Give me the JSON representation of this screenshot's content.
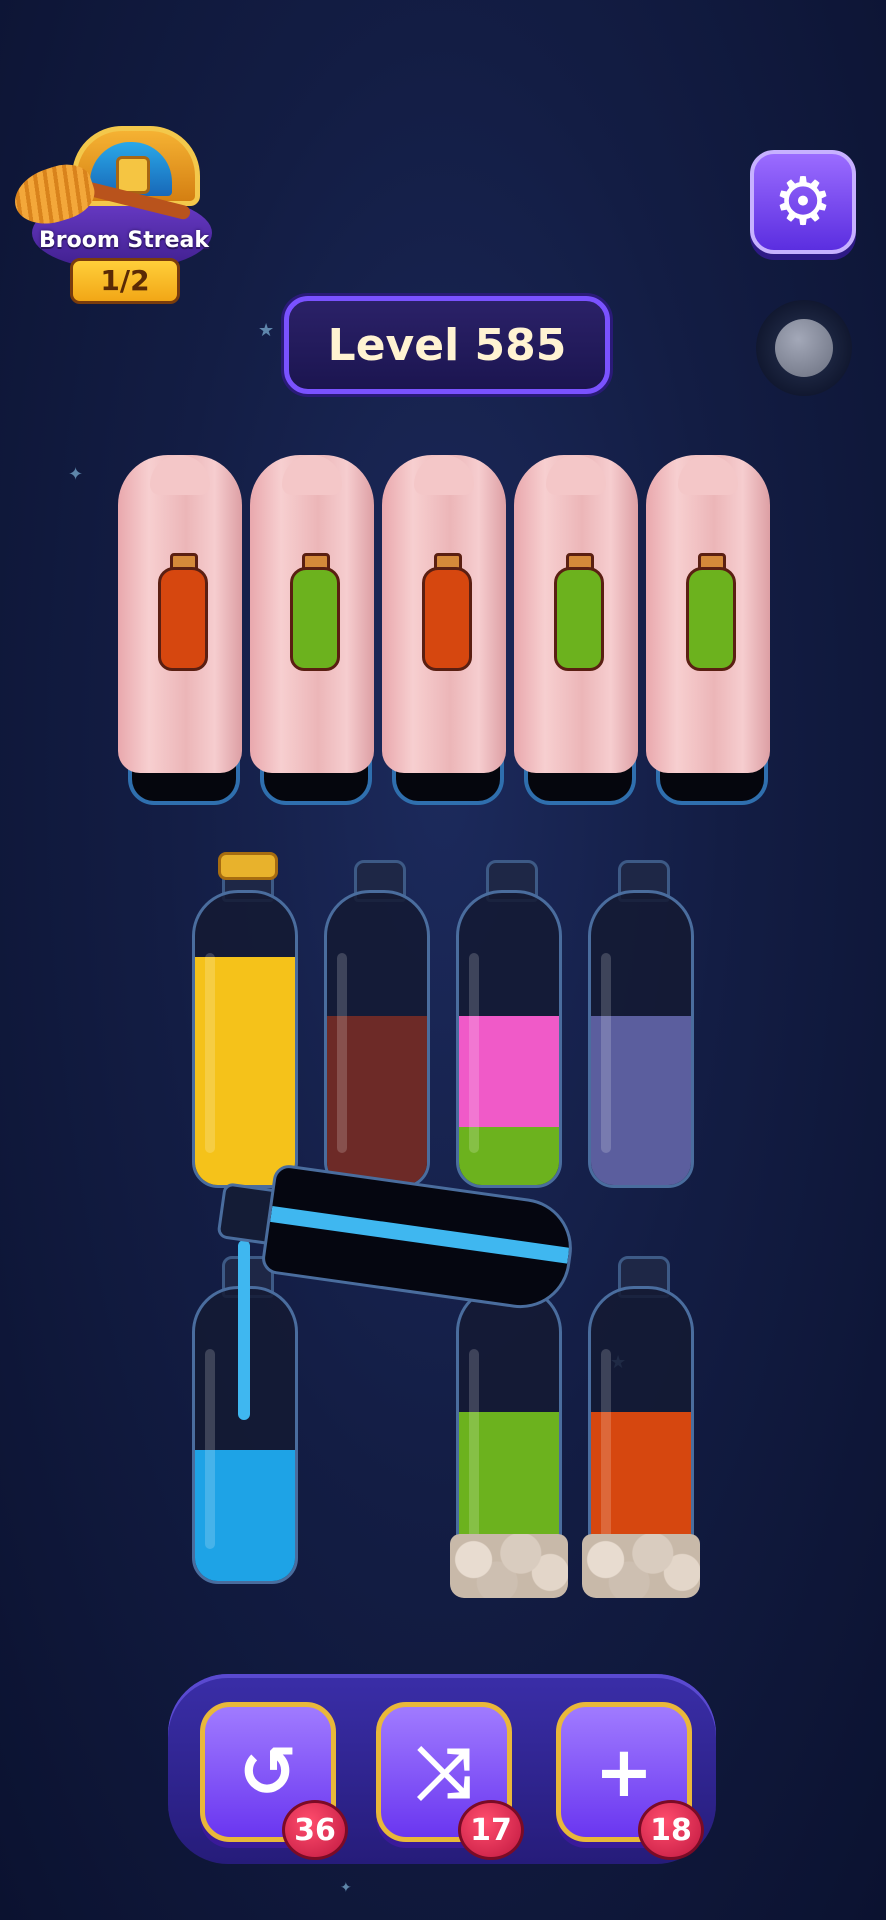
{
  "streak": {
    "title": "Broom Streak",
    "progress": "1/2"
  },
  "level": {
    "label": "Level 585"
  },
  "settings": {
    "icon": "gear-icon"
  },
  "covered_bottles": [
    {
      "hint_color": "#d6470f"
    },
    {
      "hint_color": "#6cb21e"
    },
    {
      "hint_color": "#d6470f"
    },
    {
      "hint_color": "#6cb21e"
    },
    {
      "hint_color": "#6cb21e"
    }
  ],
  "bottles": [
    {
      "layers": [
        {
          "color": "#f5c21a",
          "fraction": 0.78
        }
      ],
      "corked": true,
      "rocks": false
    },
    {
      "layers": [
        {
          "color": "#6d2a27",
          "fraction": 0.58
        }
      ],
      "corked": false,
      "rocks": false
    },
    {
      "layers": [
        {
          "color": "#6cb21e",
          "fraction": 0.2
        },
        {
          "color": "#f05ac8",
          "fraction": 0.38
        }
      ],
      "corked": false,
      "rocks": false
    },
    {
      "layers": [
        {
          "color": "#5b5e9e",
          "fraction": 0.58
        }
      ],
      "corked": false,
      "rocks": false
    },
    {
      "layers": [
        {
          "color": "#1ea3e6",
          "fraction": 0.45
        }
      ],
      "corked": false,
      "rocks": false
    },
    {
      "layers": [
        {
          "color": "#6cb21e",
          "fraction": 0.58
        }
      ],
      "corked": false,
      "rocks": true
    },
    {
      "layers": [
        {
          "color": "#d6470f",
          "fraction": 0.58
        }
      ],
      "corked": false,
      "rocks": true
    }
  ],
  "pouring": {
    "color": "#3fb7f0"
  },
  "powerups": [
    {
      "name": "undo",
      "icon": "undo-icon",
      "glyph": "↺",
      "count": "36"
    },
    {
      "name": "shuffle",
      "icon": "shuffle-icon",
      "glyph": "⤨",
      "count": "17"
    },
    {
      "name": "add-bottle",
      "icon": "add-bottle-icon",
      "glyph": "+",
      "count": "18"
    }
  ]
}
